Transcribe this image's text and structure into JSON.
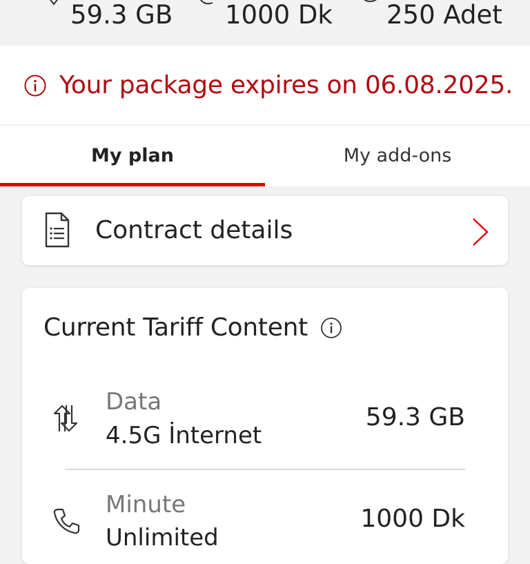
{
  "summary": {
    "data_value": "59.3 GB",
    "minutes_value": "1000 Dk",
    "sms_value": "250 Adet"
  },
  "expiry": {
    "message": "Your package expires on 06.08.2025."
  },
  "tabs": [
    {
      "label": "My plan",
      "active": true
    },
    {
      "label": "My add-ons",
      "active": false
    }
  ],
  "contract": {
    "label": "Contract details"
  },
  "tariff": {
    "title": "Current Tariff Content",
    "rows": [
      {
        "category": "Data",
        "name": "4.5G İnternet",
        "value": "59.3 GB",
        "icon": "data-transfer-icon"
      },
      {
        "category": "Minute",
        "name": "Unlimited",
        "value": "1000 Dk",
        "icon": "phone-icon"
      }
    ]
  },
  "colors": {
    "accent": "#e60000",
    "alert_text": "#b00b0f",
    "background": "#f2f2f2",
    "card": "#ffffff"
  }
}
